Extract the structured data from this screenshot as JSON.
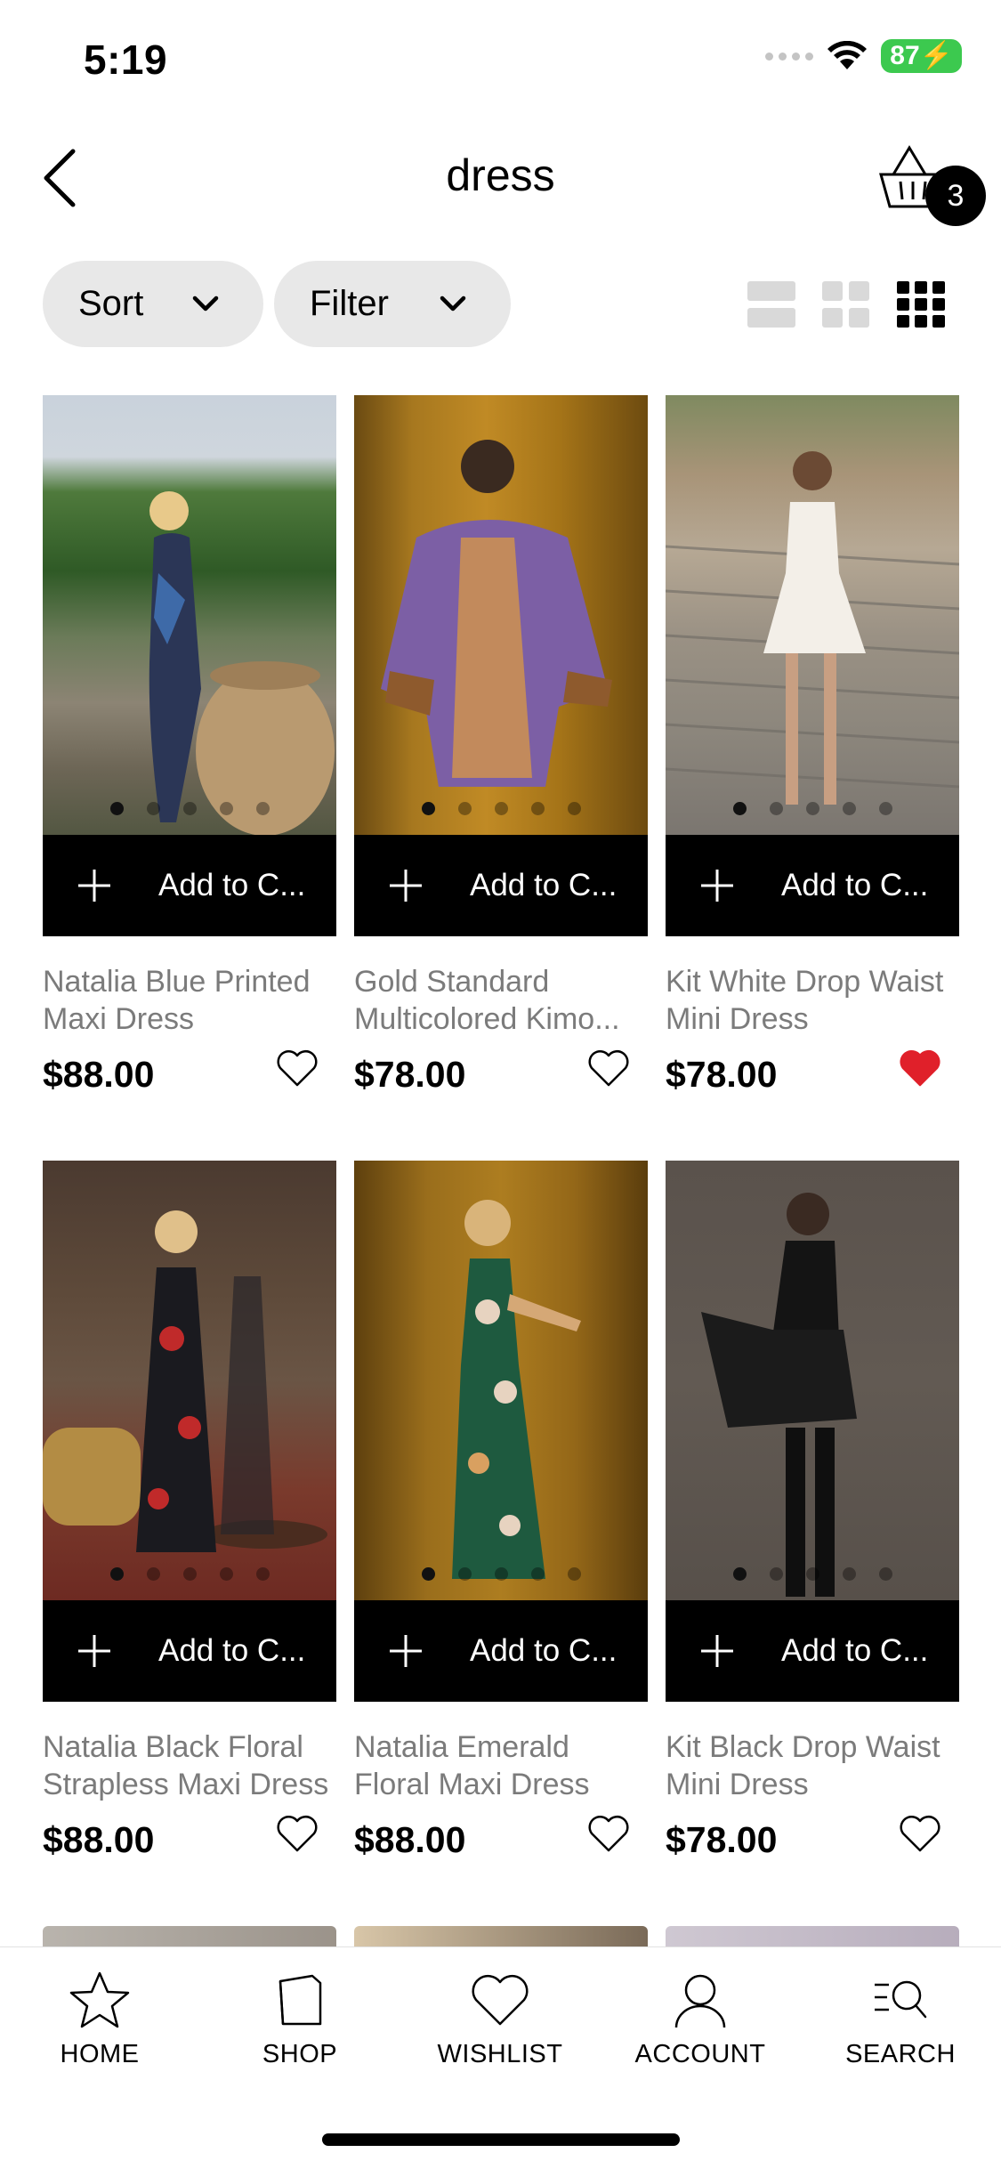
{
  "status_bar": {
    "time": "5:19",
    "battery": "87"
  },
  "header": {
    "title": "dress",
    "cart_count": "3"
  },
  "filter_bar": {
    "sort_label": "Sort",
    "filter_label": "Filter"
  },
  "product_common": {
    "add_label": "Add to C..."
  },
  "products": [
    {
      "name": "Natalia Blue Printed\nMaxi Dress",
      "price": "$88.00",
      "wishlisted": false
    },
    {
      "name": "Gold Standard\nMulticolored Kimo...",
      "price": "$78.00",
      "wishlisted": false
    },
    {
      "name": "Kit White Drop Waist\nMini Dress",
      "price": "$78.00",
      "wishlisted": true
    },
    {
      "name": "Natalia Black Floral\nStrapless Maxi Dress",
      "price": "$88.00",
      "wishlisted": false
    },
    {
      "name": "Natalia Emerald\nFloral Maxi Dress",
      "price": "$88.00",
      "wishlisted": false
    },
    {
      "name": "Kit Black Drop Waist\nMini Dress",
      "price": "$78.00",
      "wishlisted": false
    }
  ],
  "bottom_nav": [
    {
      "label": "HOME",
      "icon": "star-icon"
    },
    {
      "label": "SHOP",
      "icon": "shopping-bag-icon"
    },
    {
      "label": "WISHLIST",
      "icon": "heart-icon"
    },
    {
      "label": "ACCOUNT",
      "icon": "person-icon"
    },
    {
      "label": "SEARCH",
      "icon": "search-list-icon"
    }
  ],
  "colors": {
    "accent": "#000000",
    "wishlist_active": "#e0202a",
    "pill_bg": "#e8e8e8",
    "muted_text": "#7b7b7b"
  }
}
